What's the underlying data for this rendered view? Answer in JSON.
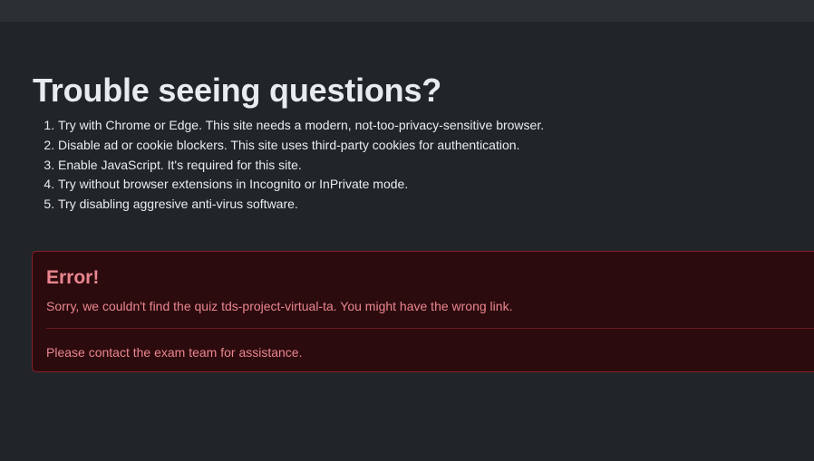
{
  "help": {
    "title": "Trouble seeing questions?",
    "items": [
      "Try with Chrome or Edge. This site needs a modern, not-too-privacy-sensitive browser.",
      "Disable ad or cookie blockers. This site uses third-party cookies for authentication.",
      "Enable JavaScript. It's required for this site.",
      "Try without browser extensions in Incognito or InPrivate mode.",
      "Try disabling aggresive anti-virus software."
    ]
  },
  "error": {
    "heading": "Error!",
    "message": "Sorry, we couldn't find the quiz tds-project-virtual-ta. You might have the wrong link.",
    "contact": "Please contact the exam team for assistance."
  },
  "colors": {
    "background": "#212529",
    "topbar": "#2b3035",
    "alert_bg": "#2c0b0e",
    "alert_border": "#842029",
    "alert_text": "#ea868f"
  }
}
